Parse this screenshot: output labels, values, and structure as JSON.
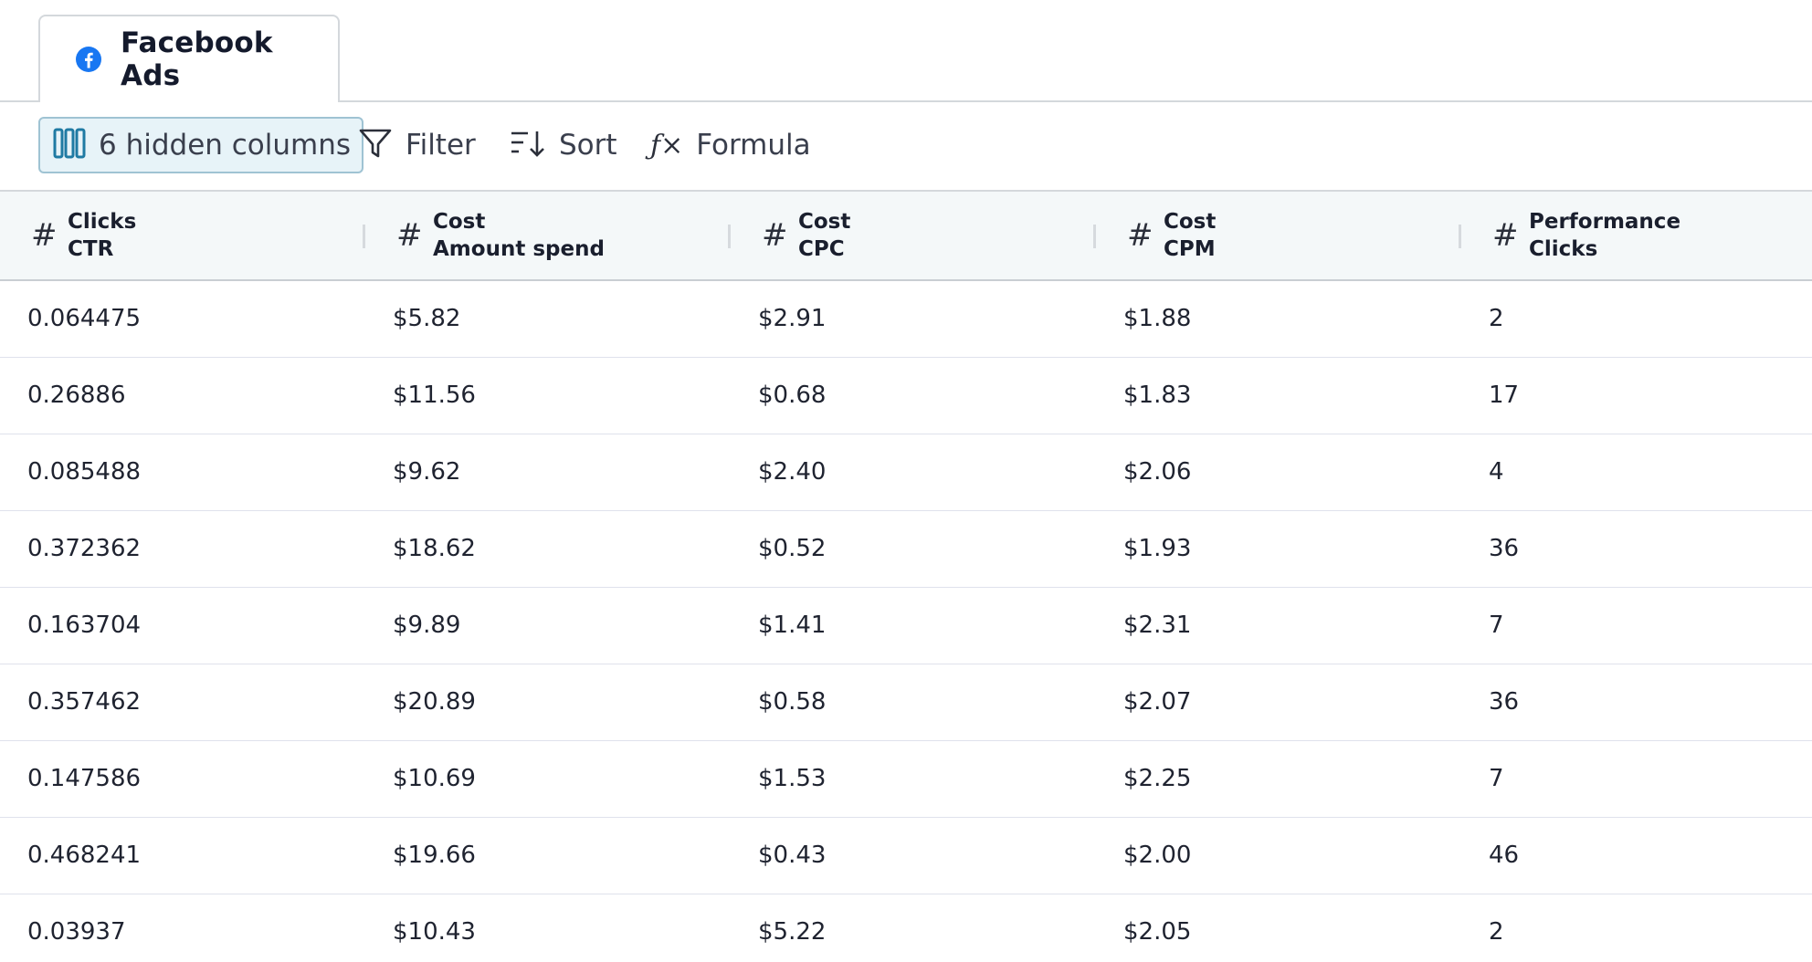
{
  "tabs": [
    {
      "label": "Facebook Ads",
      "icon": "facebook-icon",
      "active": true
    }
  ],
  "toolbar": {
    "hidden_columns_label": "6 hidden columns",
    "filter_label": "Filter",
    "sort_label": "Sort",
    "formula_label": "Formula",
    "formula_icon_text": "ƒ×"
  },
  "table": {
    "type_symbol": "#",
    "columns": [
      {
        "group": "Clicks",
        "name": "CTR"
      },
      {
        "group": "Cost",
        "name": "Amount spend"
      },
      {
        "group": "Cost",
        "name": "CPC"
      },
      {
        "group": "Cost",
        "name": "CPM"
      },
      {
        "group": "Performance",
        "name": "Clicks"
      }
    ],
    "rows": [
      [
        "0.064475",
        "$5.82",
        "$2.91",
        "$1.88",
        "2"
      ],
      [
        "0.26886",
        "$11.56",
        "$0.68",
        "$1.83",
        "17"
      ],
      [
        "0.085488",
        "$9.62",
        "$2.40",
        "$2.06",
        "4"
      ],
      [
        "0.372362",
        "$18.62",
        "$0.52",
        "$1.93",
        "36"
      ],
      [
        "0.163704",
        "$9.89",
        "$1.41",
        "$2.31",
        "7"
      ],
      [
        "0.357462",
        "$20.89",
        "$0.58",
        "$2.07",
        "36"
      ],
      [
        "0.147586",
        "$10.69",
        "$1.53",
        "$2.25",
        "7"
      ],
      [
        "0.468241",
        "$19.66",
        "$0.43",
        "$2.00",
        "46"
      ],
      [
        "0.03937",
        "$10.43",
        "$5.22",
        "$2.05",
        "2"
      ]
    ]
  },
  "colors": {
    "facebook_blue": "#1877f2",
    "accent_teal": "#1f7aa3",
    "header_bg": "#f4f8f9"
  }
}
